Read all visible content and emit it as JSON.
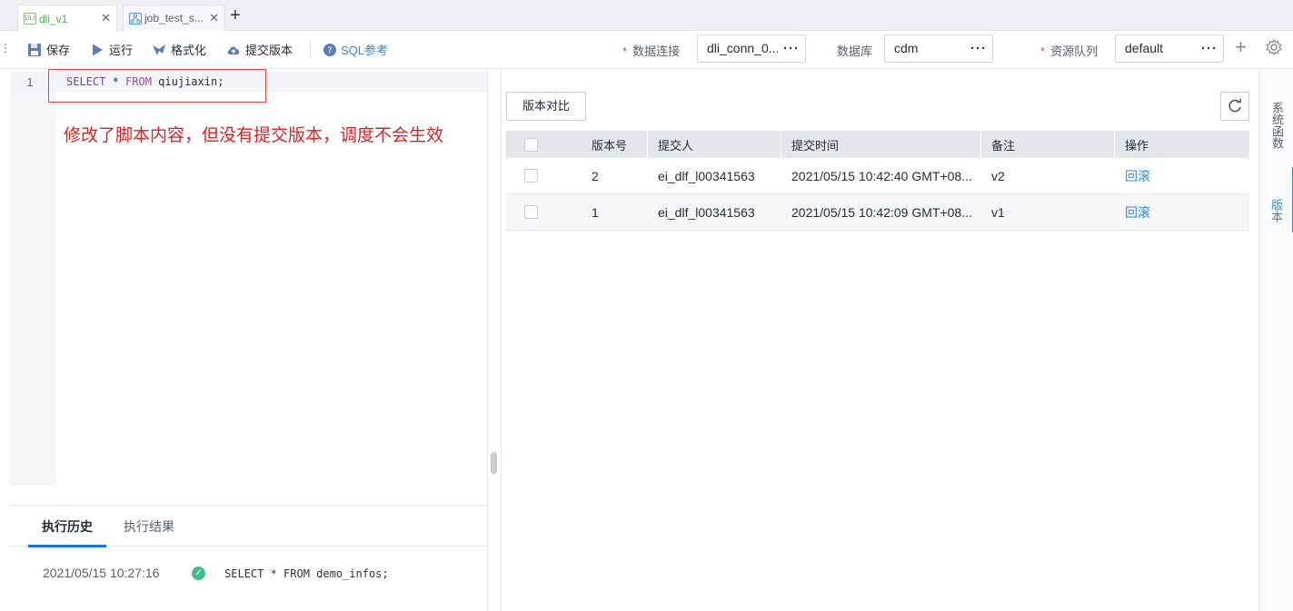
{
  "tabs": [
    {
      "label": "dli_v1",
      "icon": "dli-file-icon",
      "icon_text": "DLI",
      "active": true
    },
    {
      "label": "job_test_s...",
      "icon": "job-flow-icon",
      "active": false
    }
  ],
  "toolbar": {
    "save_label": "保存",
    "run_label": "运行",
    "format_label": "格式化",
    "submit_label": "提交版本",
    "sql_ref_label": "SQL参考",
    "connection_label": "数据连接",
    "connection_value": "dli_conn_0...",
    "database_label": "数据库",
    "database_value": "cdm",
    "queue_label": "资源队列",
    "queue_value": "default",
    "required_mark": "*"
  },
  "editor": {
    "line_number": "1",
    "code_kw1": "SELECT",
    "code_mid": " * ",
    "code_kw2": "FROM",
    "code_rest": " qiujiaxin;",
    "annotation": "修改了脚本内容，但没有提交版本，调度不会生效"
  },
  "bottom": {
    "tab_history": "执行历史",
    "tab_result": "执行结果",
    "history_time": "2021/05/15 10:27:16",
    "history_sql": "SELECT * FROM demo_infos;",
    "history_status": "success"
  },
  "versions": {
    "compare_label": "版本对比",
    "columns": [
      "版本号",
      "提交人",
      "提交时间",
      "备注",
      "操作"
    ],
    "rows": [
      {
        "version": "2",
        "submitter": "ei_dlf_l00341563",
        "time": "2021/05/15 10:42:40 GMT+08...",
        "note": "v2",
        "action": "回滚"
      },
      {
        "version": "1",
        "submitter": "ei_dlf_l00341563",
        "time": "2021/05/15 10:42:09 GMT+08...",
        "note": "v1",
        "action": "回滚"
      }
    ]
  },
  "side_tabs": {
    "functions": "系统函数",
    "version": "版本"
  },
  "colors": {
    "accent": "#2a8ce5",
    "annotation": "#e02020",
    "success": "#3dbf8a"
  }
}
